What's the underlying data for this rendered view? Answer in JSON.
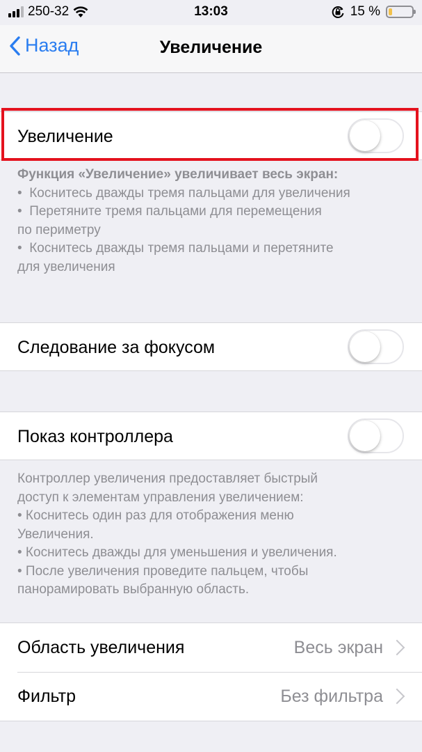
{
  "status": {
    "carrier": "250-32",
    "time": "13:03",
    "battery": "15 %",
    "battery_level": 0.15,
    "icons": [
      "signal-bars-icon",
      "wifi-icon",
      "orientation-lock-icon",
      "battery-icon"
    ]
  },
  "nav": {
    "back_label": "Назад",
    "title": "Увеличение"
  },
  "zoom": {
    "label": "Увеличение",
    "enabled": false
  },
  "zoom_footer": {
    "lines": [
      "Функция «Увеличение» увеличивает весь экран:",
      "•  Коснитесь дважды тремя пальцами для увеличения",
      "•  Перетяните тремя пальцами для перемещения",
      "по периметру",
      "•  Коснитесь дважды тремя пальцами и перетяните",
      "для увеличения"
    ]
  },
  "follow_focus": {
    "label": "Следование за фокусом",
    "enabled": false
  },
  "controller": {
    "label": "Показ контроллера",
    "enabled": false
  },
  "controller_footer": {
    "lines": [
      "Контроллер увеличения предоставляет быстрый",
      "доступ к элементам управления увеличением:",
      "• Коснитесь один раз для отображения меню",
      "Увеличения.",
      "• Коснитесь дважды для уменьшения и увеличения.",
      "• После увеличения проведите пальцем, чтобы",
      "панорамировать выбранную область."
    ]
  },
  "region": {
    "label": "Область увеличения",
    "value": "Весь экран"
  },
  "filter": {
    "label": "Фильтр",
    "value": "Без фильтра"
  },
  "colors": {
    "accent": "#2a7df0",
    "highlight": "#e4121e",
    "battery": "#f2c14c",
    "background": "#efeff4"
  }
}
